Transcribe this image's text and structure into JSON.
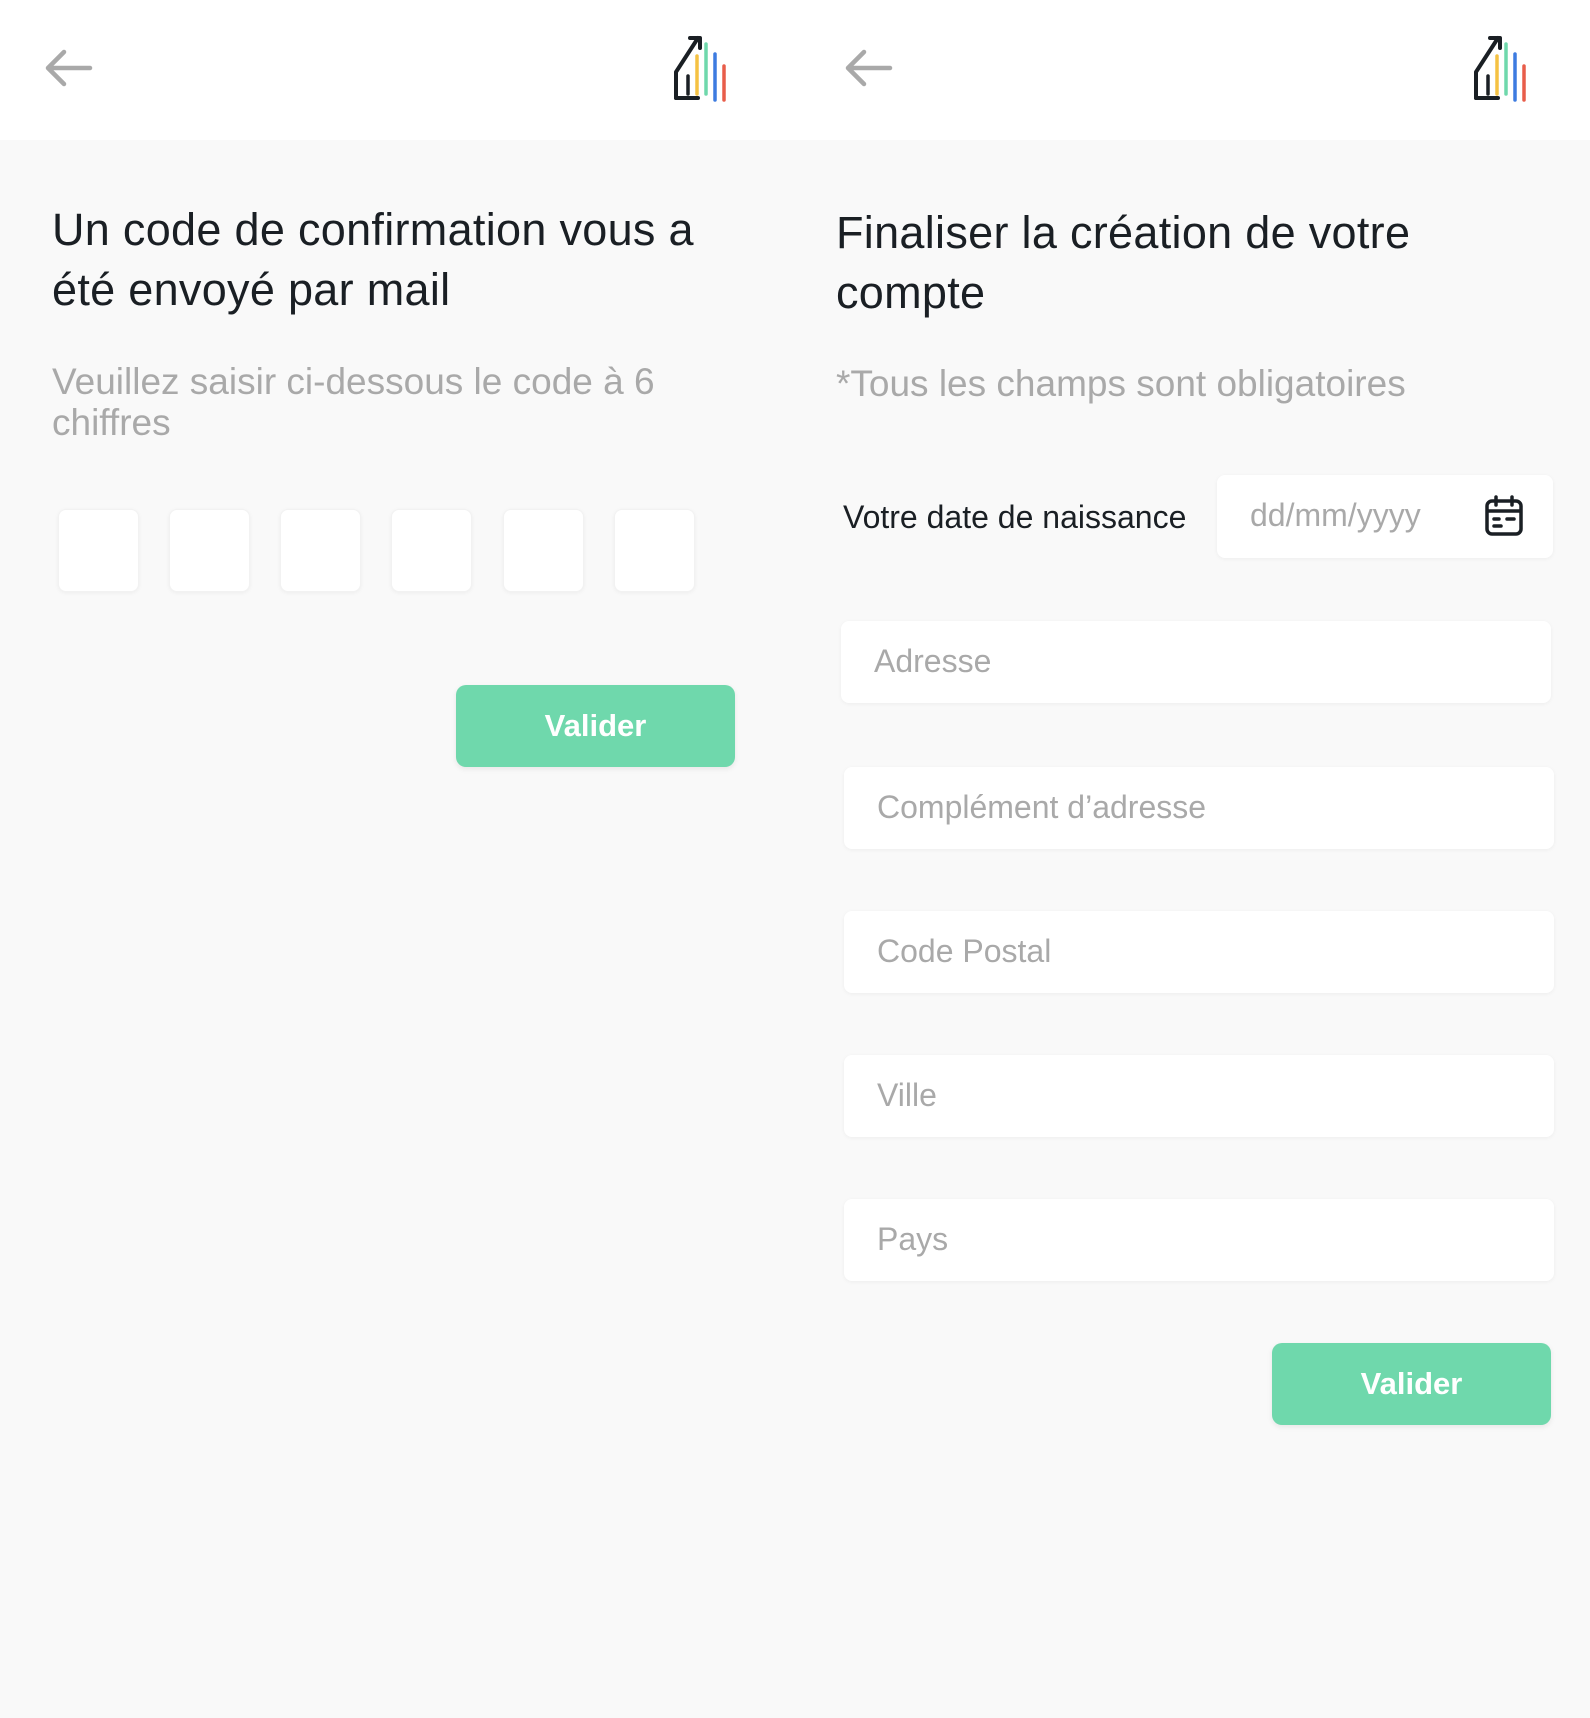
{
  "colors": {
    "accent": "#6fd8ac",
    "background": "#f9f9f9",
    "title_text": "#1a1f24",
    "placeholder_text": "#a9a9a9",
    "logo_bars": [
      "#1a1f24",
      "#f5c243",
      "#6fd8ac",
      "#3d7be0",
      "#e85d4a"
    ]
  },
  "left": {
    "back_icon": "arrow-left-icon",
    "logo_icon": "chart-house-logo",
    "title_line1": "Un code de confirmation vous a",
    "title_line2": "été envoyé par mail",
    "subtitle_line1": "Veuillez saisir ci-dessous le code à 6",
    "subtitle_line2": "chiffres",
    "code_length": 6,
    "submit_label": "Valider"
  },
  "right": {
    "back_icon": "arrow-left-icon",
    "logo_icon": "chart-house-logo",
    "title_line1": "Finaliser la création de votre",
    "title_line2": "compte",
    "subtitle": "*Tous les champs sont obligatoires",
    "dob_label": "Votre date de naissance",
    "dob_placeholder": "dd/mm/yyyy",
    "calendar_icon": "calendar-icon",
    "fields": {
      "address": "Adresse",
      "address_complement": "Complément d’adresse",
      "postal_code": "Code Postal",
      "city": "Ville",
      "country": "Pays"
    },
    "submit_label": "Valider"
  }
}
